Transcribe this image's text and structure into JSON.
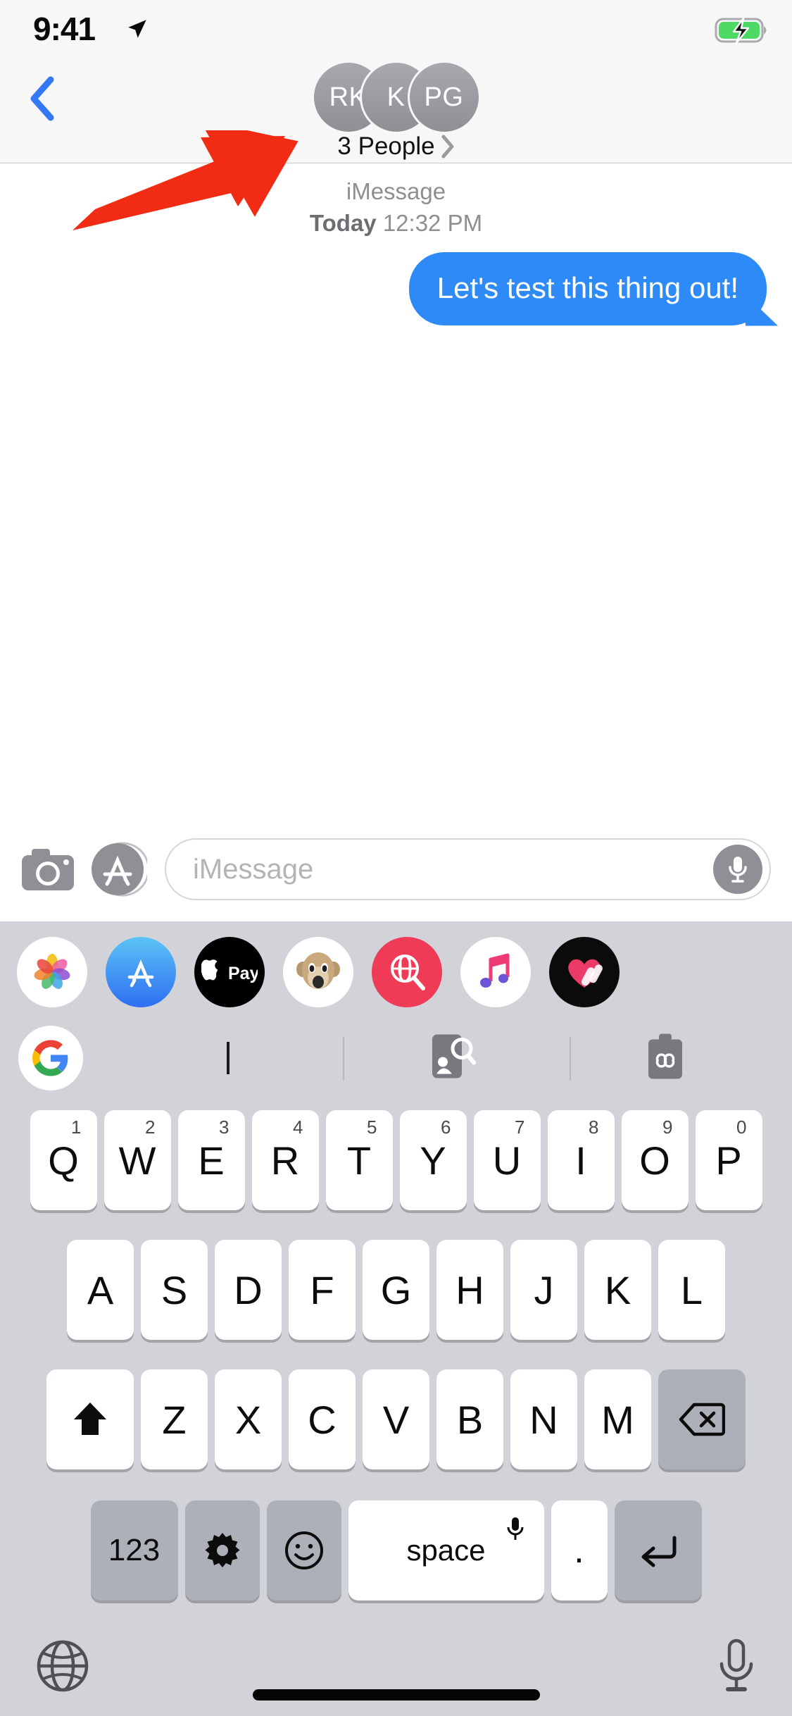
{
  "status_bar": {
    "time": "9:41",
    "location_icon": "location-arrow-icon",
    "battery_icon": "battery-charging-icon",
    "battery_color": "#4cd964"
  },
  "nav": {
    "back_icon": "back-chevron-icon",
    "back_color": "#3478f6",
    "avatars": [
      {
        "initials": "RK"
      },
      {
        "initials": "K"
      },
      {
        "initials": "PG"
      }
    ],
    "people_label": "3 People",
    "people_chevron_icon": "chevron-right-icon",
    "avatar_color": "#8e9096"
  },
  "conversation": {
    "service": "iMessage",
    "day": "Today",
    "time": "12:32 PM",
    "messages": [
      {
        "text": "Let's test this thing out!",
        "sender": "me",
        "bubble_color": "#2e8af7",
        "text_color": "#ffffff"
      }
    ]
  },
  "input_bar": {
    "camera_icon": "camera-icon",
    "appstore_icon": "app-store-icon",
    "placeholder": "iMessage",
    "mic_icon": "microphone-icon"
  },
  "app_drawer": [
    {
      "name": "photos-app-icon",
      "label": "Photos",
      "bg": "#ffffff"
    },
    {
      "name": "app-store-app-icon",
      "label": "App Store",
      "bg": "#3f8ef7"
    },
    {
      "name": "apple-pay-app-icon",
      "label": "Apple Pay",
      "bg": "#000000"
    },
    {
      "name": "memoji-app-icon",
      "label": "Memoji",
      "bg": "#ffffff"
    },
    {
      "name": "images-search-app-icon",
      "label": "#images",
      "bg": "#ef3b56"
    },
    {
      "name": "music-app-icon",
      "label": "Music",
      "bg": "#ffffff"
    },
    {
      "name": "digital-touch-app-icon",
      "label": "Digital Touch",
      "bg": "#0b0b0b"
    }
  ],
  "suggestion_bar": {
    "google_icon": "google-g-icon",
    "cursor": "text-cursor",
    "image_search_icon": "image-search-icon",
    "gif_icon": "gif-sticker-icon"
  },
  "keyboard": {
    "row1": [
      {
        "letter": "Q",
        "sup": "1"
      },
      {
        "letter": "W",
        "sup": "2"
      },
      {
        "letter": "E",
        "sup": "3"
      },
      {
        "letter": "R",
        "sup": "4"
      },
      {
        "letter": "T",
        "sup": "5"
      },
      {
        "letter": "Y",
        "sup": "6"
      },
      {
        "letter": "U",
        "sup": "7"
      },
      {
        "letter": "I",
        "sup": "8"
      },
      {
        "letter": "O",
        "sup": "9"
      },
      {
        "letter": "P",
        "sup": "0"
      }
    ],
    "row2": [
      "A",
      "S",
      "D",
      "F",
      "G",
      "H",
      "J",
      "K",
      "L"
    ],
    "row3": [
      "Z",
      "X",
      "C",
      "V",
      "B",
      "N",
      "M"
    ],
    "shift_icon": "shift-icon",
    "backspace_icon": "backspace-icon",
    "numeric_label": "123",
    "gear_icon": "gear-icon",
    "emoji_icon": "emoji-smiley-icon",
    "space_label": "space",
    "space_mic_icon": "microphone-icon",
    "period_label": ".",
    "enter_icon": "enter-return-icon",
    "globe_icon": "globe-icon",
    "mic_icon": "microphone-icon"
  },
  "annotation": {
    "arrow_icon": "red-arrow-annotation",
    "color": "#f22c14"
  }
}
